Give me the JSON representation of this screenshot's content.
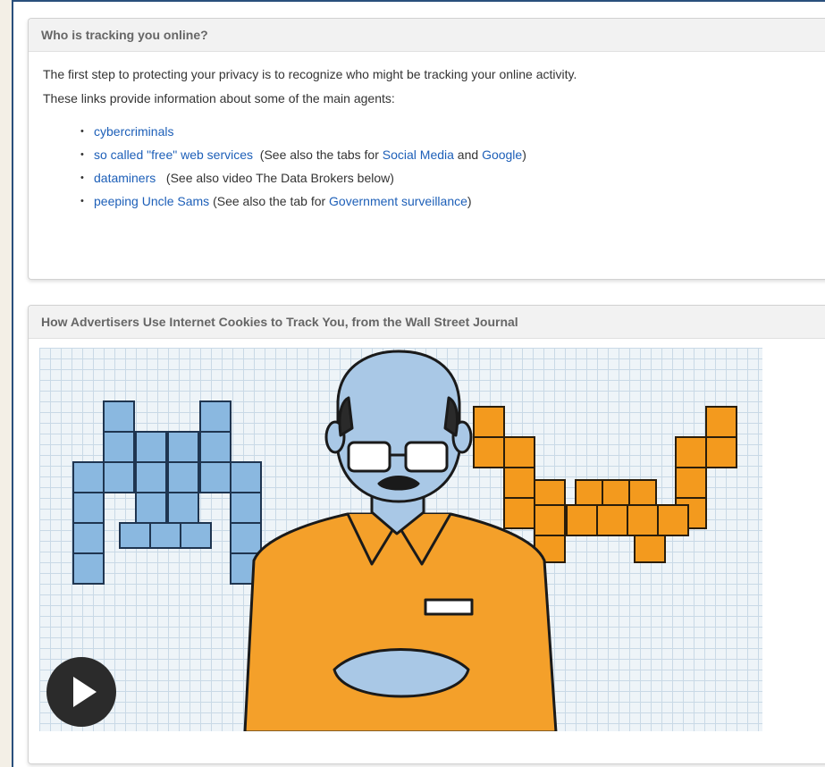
{
  "tracking_panel": {
    "title": "Who is tracking you online?",
    "intro_line1": "The first step to protecting your privacy is to recognize who might be tracking your online activity.",
    "intro_line2": "These links provide information about some of the main agents:",
    "items": [
      {
        "link": "cybercriminals"
      },
      {
        "link": "so called \"free\" web services",
        "pre": "  (See also the tabs for ",
        "link2": "Social Media",
        "mid": " and ",
        "link3": "Google",
        "post": ")"
      },
      {
        "link": "dataminers",
        "post": "   (See also video The Data Brokers below)"
      },
      {
        "link": "peeping Uncle Sams",
        "pre": " (See also the tab for ",
        "link2": "Government surveillance",
        "post": ")"
      }
    ]
  },
  "video_panel": {
    "title": "How Advertisers Use Internet Cookies to Track You, from the Wall Street Journal",
    "play_icon": "play-icon"
  },
  "colors": {
    "link": "#1d5fb8",
    "frame_border": "#294f7c",
    "blue_blocks": "#8ab8e0",
    "orange_blocks": "#f39a1e",
    "shirt": "#f4a02a",
    "skin": "#a9c8e6"
  }
}
